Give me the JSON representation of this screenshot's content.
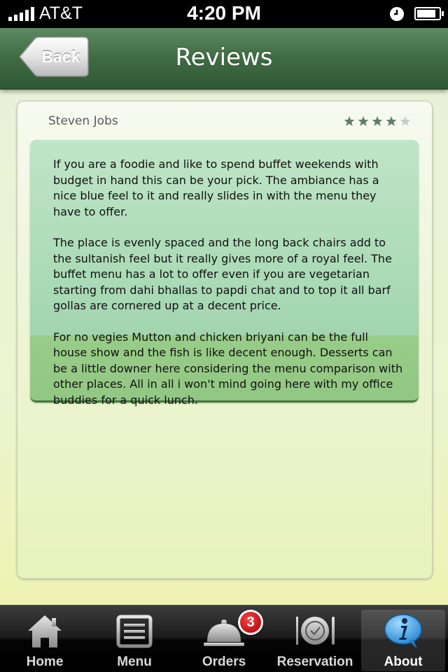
{
  "status_bar": {
    "carrier": "AT&T",
    "time": "4:20 PM",
    "icons": [
      "signal-bars-icon",
      "alarm-clock-icon",
      "battery-icon"
    ]
  },
  "nav": {
    "title": "Reviews",
    "back_label": "Back"
  },
  "review": {
    "author": "Steven Jobs",
    "rating": 4,
    "max_rating": 5,
    "paragraphs": [
      "If you are a foodie and like to spend buffet weekends with budget in hand this can be your pick. The ambiance has a nice blue feel to it and really slides in with the menu they have to offer.",
      "The place is evenly spaced and the long back chairs add to the sultanish feel but it really gives more of a royal feel. The buffet menu has a lot to offer even if you are vegetarian starting from dahi bhallas to papdi chat and to top it all barf gollas are cornered up at a decent price.",
      "For no vegies Mutton and chicken briyani can be the full house show and the fish is like decent enough. Desserts can be a little downer here considering the menu comparison with other places. All in all i won't mind going here with my office buddies for a quick lunch."
    ]
  },
  "tabs": [
    {
      "label": "Home",
      "icon": "house-icon",
      "selected": false
    },
    {
      "label": "Menu",
      "icon": "menu-list-icon",
      "selected": false
    },
    {
      "label": "Orders",
      "icon": "cloche-icon",
      "selected": false,
      "badge": "3"
    },
    {
      "label": "Reservation",
      "icon": "plate-cutlery-icon",
      "selected": false
    },
    {
      "label": "About",
      "icon": "info-bubble-icon",
      "selected": true
    }
  ],
  "colors": {
    "nav_green": "#3f6b43",
    "star_filled": "#5e7e67",
    "star_empty": "#c8ccc4",
    "badge_red": "#c40f12",
    "about_icon_blue": "#2a8ad4"
  }
}
